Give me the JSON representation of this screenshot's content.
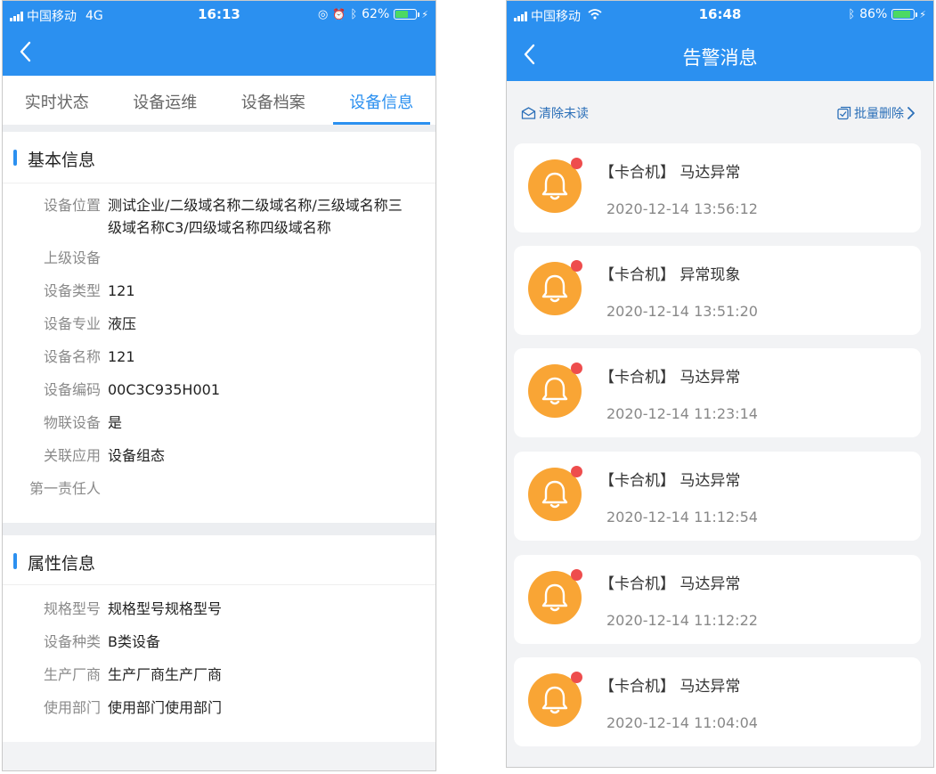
{
  "left": {
    "status": {
      "carrier": "中国移动",
      "network": "4G",
      "time": "16:13",
      "battery": "62%"
    },
    "tabs": [
      "实时状态",
      "设备运维",
      "设备档案",
      "设备信息"
    ],
    "basic": {
      "title": "基本信息",
      "rows": [
        {
          "label": "设备位置",
          "value": "测试企业/二级域名称二级域名称/三级域名称三级域名称C3/四级域名称四级域名称"
        },
        {
          "label": "上级设备",
          "value": ""
        },
        {
          "label": "设备类型",
          "value": "121"
        },
        {
          "label": "设备专业",
          "value": "液压"
        },
        {
          "label": "设备名称",
          "value": "121"
        },
        {
          "label": "设备编码",
          "value": "00C3C935H001"
        },
        {
          "label": "物联设备",
          "value": "是"
        },
        {
          "label": "关联应用",
          "value": "设备组态"
        },
        {
          "label": "第一责任人",
          "value": ""
        }
      ]
    },
    "attr": {
      "title": "属性信息",
      "rows": [
        {
          "label": "规格型号",
          "value": "规格型号规格型号"
        },
        {
          "label": "设备种类",
          "value": "B类设备"
        },
        {
          "label": "生产厂商",
          "value": "生产厂商生产厂商"
        },
        {
          "label": "使用部门",
          "value": "使用部门使用部门"
        }
      ]
    }
  },
  "right": {
    "status": {
      "carrier": "中国移动",
      "time": "16:48",
      "battery": "86%"
    },
    "title": "告警消息",
    "clear_unread": "清除未读",
    "batch_delete": "批量删除",
    "messages": [
      {
        "title": "【卡合机】 马达异常",
        "time": "2020-12-14 13:56:12"
      },
      {
        "title": "【卡合机】 异常现象",
        "time": "2020-12-14 13:51:20"
      },
      {
        "title": "【卡合机】 马达异常",
        "time": "2020-12-14 11:23:14"
      },
      {
        "title": "【卡合机】 马达异常",
        "time": "2020-12-14 11:12:54"
      },
      {
        "title": "【卡合机】 马达异常",
        "time": "2020-12-14 11:12:22"
      },
      {
        "title": "【卡合机】 马达异常",
        "time": "2020-12-14 11:04:04"
      }
    ]
  },
  "colors": {
    "primary": "#2b90f0",
    "bell": "#f9a535",
    "unread_dot": "#ee4d4d"
  }
}
